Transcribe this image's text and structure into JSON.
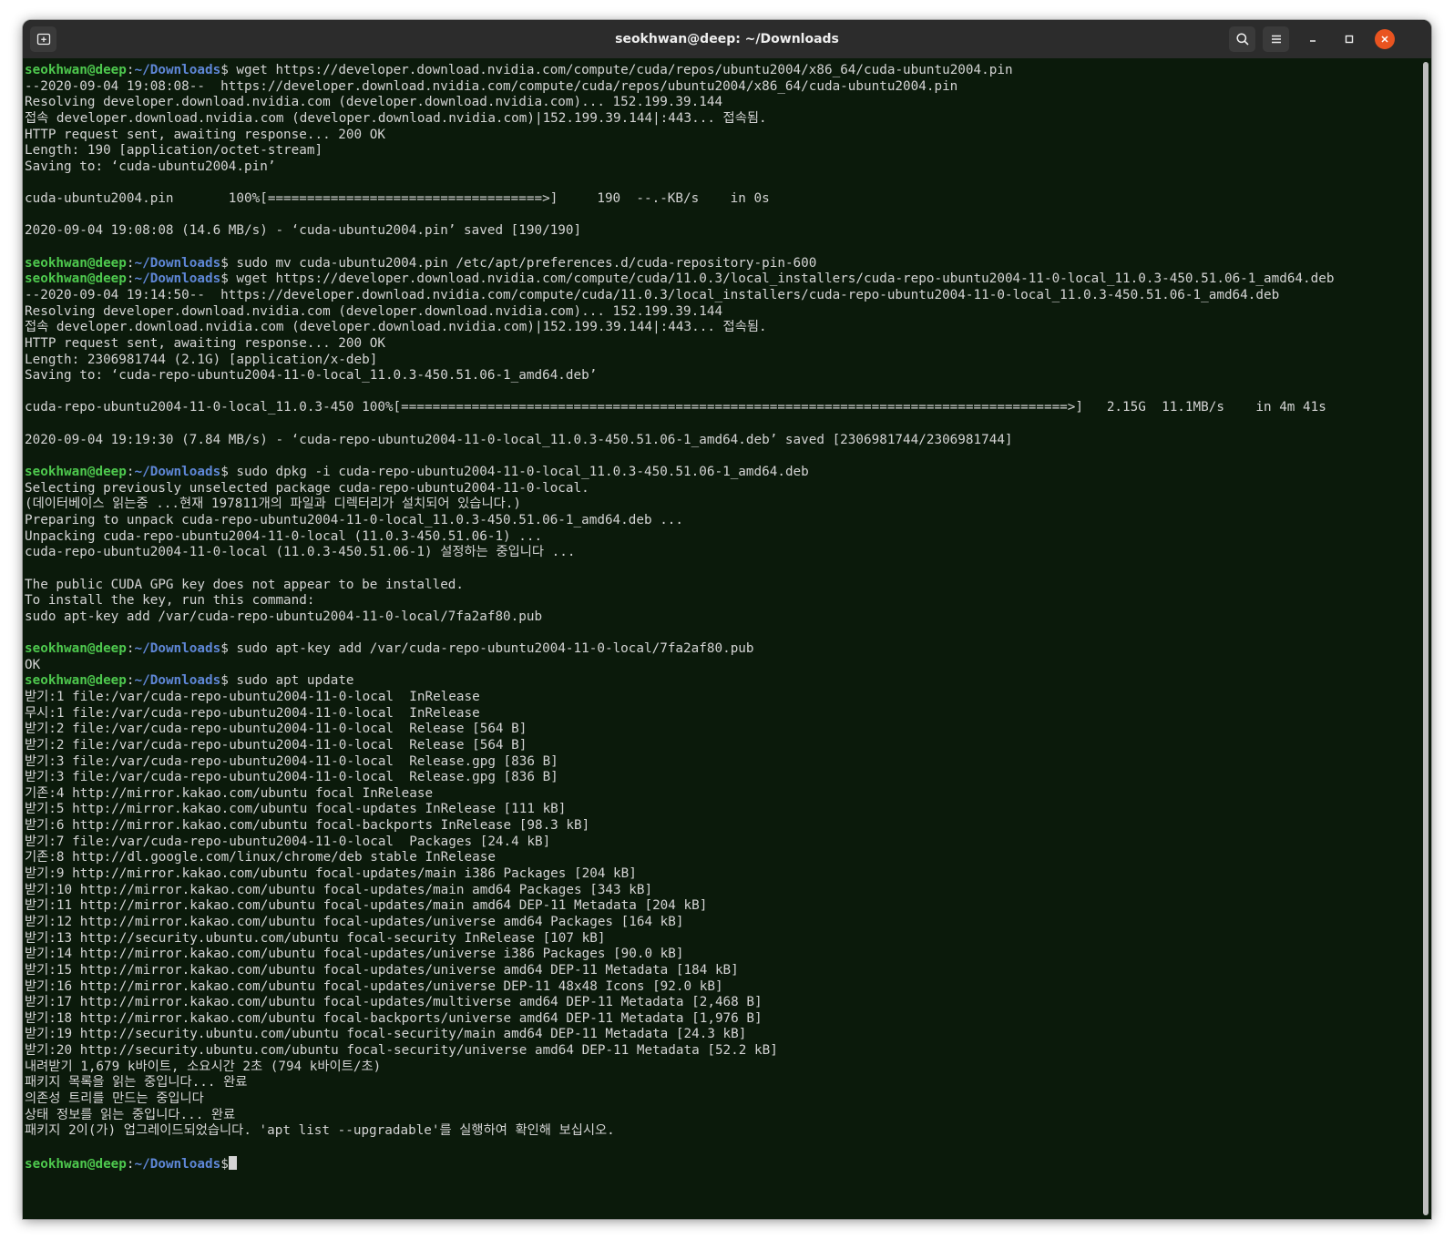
{
  "window": {
    "title": "seokhwan@deep: ~/Downloads"
  },
  "icons": {
    "new_tab": "new-tab-icon",
    "search": "search-icon",
    "menu": "hamburger-menu-icon",
    "minimize": "minimize-icon",
    "maximize": "maximize-icon",
    "close": "close-icon"
  },
  "colors": {
    "terminal_bg": "#0b1a0b",
    "prompt_user": "#4ec94e",
    "prompt_path": "#5f87d7",
    "text": "#d4d4d4",
    "close_button": "#e95420"
  },
  "prompt": {
    "user": "seokhwan@deep",
    "sep": ":",
    "path": "~/Downloads",
    "dollar": "$"
  },
  "lines": [
    {
      "cmd": " wget https://developer.download.nvidia.com/compute/cuda/repos/ubuntu2004/x86_64/cuda-ubuntu2004.pin"
    },
    {
      "text": "--2020-09-04 19:08:08--  https://developer.download.nvidia.com/compute/cuda/repos/ubuntu2004/x86_64/cuda-ubuntu2004.pin"
    },
    {
      "text": "Resolving developer.download.nvidia.com (developer.download.nvidia.com)... 152.199.39.144"
    },
    {
      "text": "접속 developer.download.nvidia.com (developer.download.nvidia.com)|152.199.39.144|:443... 접속됨."
    },
    {
      "text": "HTTP request sent, awaiting response... 200 OK"
    },
    {
      "text": "Length: 190 [application/octet-stream]"
    },
    {
      "text": "Saving to: ‘cuda-ubuntu2004.pin’"
    },
    {
      "text": ""
    },
    {
      "text": "cuda-ubuntu2004.pin       100%[===================================>]     190  --.-KB/s    in 0s"
    },
    {
      "text": ""
    },
    {
      "text": "2020-09-04 19:08:08 (14.6 MB/s) - ‘cuda-ubuntu2004.pin’ saved [190/190]"
    },
    {
      "text": ""
    },
    {
      "cmd": " sudo mv cuda-ubuntu2004.pin /etc/apt/preferences.d/cuda-repository-pin-600"
    },
    {
      "cmd": " wget https://developer.download.nvidia.com/compute/cuda/11.0.3/local_installers/cuda-repo-ubuntu2004-11-0-local_11.0.3-450.51.06-1_amd64.deb"
    },
    {
      "text": "--2020-09-04 19:14:50--  https://developer.download.nvidia.com/compute/cuda/11.0.3/local_installers/cuda-repo-ubuntu2004-11-0-local_11.0.3-450.51.06-1_amd64.deb"
    },
    {
      "text": "Resolving developer.download.nvidia.com (developer.download.nvidia.com)... 152.199.39.144"
    },
    {
      "text": "접속 developer.download.nvidia.com (developer.download.nvidia.com)|152.199.39.144|:443... 접속됨."
    },
    {
      "text": "HTTP request sent, awaiting response... 200 OK"
    },
    {
      "text": "Length: 2306981744 (2.1G) [application/x-deb]"
    },
    {
      "text": "Saving to: ‘cuda-repo-ubuntu2004-11-0-local_11.0.3-450.51.06-1_amd64.deb’"
    },
    {
      "text": ""
    },
    {
      "text": "cuda-repo-ubuntu2004-11-0-local_11.0.3-450 100%[=====================================================================================>]   2.15G  11.1MB/s    in 4m 41s"
    },
    {
      "text": ""
    },
    {
      "text": "2020-09-04 19:19:30 (7.84 MB/s) - ‘cuda-repo-ubuntu2004-11-0-local_11.0.3-450.51.06-1_amd64.deb’ saved [2306981744/2306981744]"
    },
    {
      "text": ""
    },
    {
      "cmd": " sudo dpkg -i cuda-repo-ubuntu2004-11-0-local_11.0.3-450.51.06-1_amd64.deb"
    },
    {
      "text": "Selecting previously unselected package cuda-repo-ubuntu2004-11-0-local."
    },
    {
      "text": "(데이터베이스 읽는중 ...현재 197811개의 파일과 디렉터리가 설치되어 있습니다.)"
    },
    {
      "text": "Preparing to unpack cuda-repo-ubuntu2004-11-0-local_11.0.3-450.51.06-1_amd64.deb ..."
    },
    {
      "text": "Unpacking cuda-repo-ubuntu2004-11-0-local (11.0.3-450.51.06-1) ..."
    },
    {
      "text": "cuda-repo-ubuntu2004-11-0-local (11.0.3-450.51.06-1) 설정하는 중입니다 ..."
    },
    {
      "text": ""
    },
    {
      "text": "The public CUDA GPG key does not appear to be installed."
    },
    {
      "text": "To install the key, run this command:"
    },
    {
      "text": "sudo apt-key add /var/cuda-repo-ubuntu2004-11-0-local/7fa2af80.pub"
    },
    {
      "text": ""
    },
    {
      "cmd": " sudo apt-key add /var/cuda-repo-ubuntu2004-11-0-local/7fa2af80.pub"
    },
    {
      "text": "OK"
    },
    {
      "cmd": " sudo apt update"
    },
    {
      "text": "받기:1 file:/var/cuda-repo-ubuntu2004-11-0-local  InRelease"
    },
    {
      "text": "무시:1 file:/var/cuda-repo-ubuntu2004-11-0-local  InRelease"
    },
    {
      "text": "받기:2 file:/var/cuda-repo-ubuntu2004-11-0-local  Release [564 B]"
    },
    {
      "text": "받기:2 file:/var/cuda-repo-ubuntu2004-11-0-local  Release [564 B]"
    },
    {
      "text": "받기:3 file:/var/cuda-repo-ubuntu2004-11-0-local  Release.gpg [836 B]"
    },
    {
      "text": "받기:3 file:/var/cuda-repo-ubuntu2004-11-0-local  Release.gpg [836 B]"
    },
    {
      "text": "기존:4 http://mirror.kakao.com/ubuntu focal InRelease"
    },
    {
      "text": "받기:5 http://mirror.kakao.com/ubuntu focal-updates InRelease [111 kB]"
    },
    {
      "text": "받기:6 http://mirror.kakao.com/ubuntu focal-backports InRelease [98.3 kB]"
    },
    {
      "text": "받기:7 file:/var/cuda-repo-ubuntu2004-11-0-local  Packages [24.4 kB]"
    },
    {
      "text": "기존:8 http://dl.google.com/linux/chrome/deb stable InRelease"
    },
    {
      "text": "받기:9 http://mirror.kakao.com/ubuntu focal-updates/main i386 Packages [204 kB]"
    },
    {
      "text": "받기:10 http://mirror.kakao.com/ubuntu focal-updates/main amd64 Packages [343 kB]"
    },
    {
      "text": "받기:11 http://mirror.kakao.com/ubuntu focal-updates/main amd64 DEP-11 Metadata [204 kB]"
    },
    {
      "text": "받기:12 http://mirror.kakao.com/ubuntu focal-updates/universe amd64 Packages [164 kB]"
    },
    {
      "text": "받기:13 http://security.ubuntu.com/ubuntu focal-security InRelease [107 kB]"
    },
    {
      "text": "받기:14 http://mirror.kakao.com/ubuntu focal-updates/universe i386 Packages [90.0 kB]"
    },
    {
      "text": "받기:15 http://mirror.kakao.com/ubuntu focal-updates/universe amd64 DEP-11 Metadata [184 kB]"
    },
    {
      "text": "받기:16 http://mirror.kakao.com/ubuntu focal-updates/universe DEP-11 48x48 Icons [92.0 kB]"
    },
    {
      "text": "받기:17 http://mirror.kakao.com/ubuntu focal-updates/multiverse amd64 DEP-11 Metadata [2,468 B]"
    },
    {
      "text": "받기:18 http://mirror.kakao.com/ubuntu focal-backports/universe amd64 DEP-11 Metadata [1,976 B]"
    },
    {
      "text": "받기:19 http://security.ubuntu.com/ubuntu focal-security/main amd64 DEP-11 Metadata [24.3 kB]"
    },
    {
      "text": "받기:20 http://security.ubuntu.com/ubuntu focal-security/universe amd64 DEP-11 Metadata [52.2 kB]"
    },
    {
      "text": "내려받기 1,679 k바이트, 소요시간 2초 (794 k바이트/초)"
    },
    {
      "text": "패키지 목록을 읽는 중입니다... 완료"
    },
    {
      "text": "의존성 트리를 만드는 중입니다"
    },
    {
      "text": "상태 정보를 읽는 중입니다... 완료"
    },
    {
      "text": "패키지 2이(가) 업그레이드되었습니다. 'apt list --upgradable'를 실행하여 확인해 보십시오."
    },
    {
      "text": ""
    },
    {
      "cmd": "",
      "cursor": true
    }
  ]
}
